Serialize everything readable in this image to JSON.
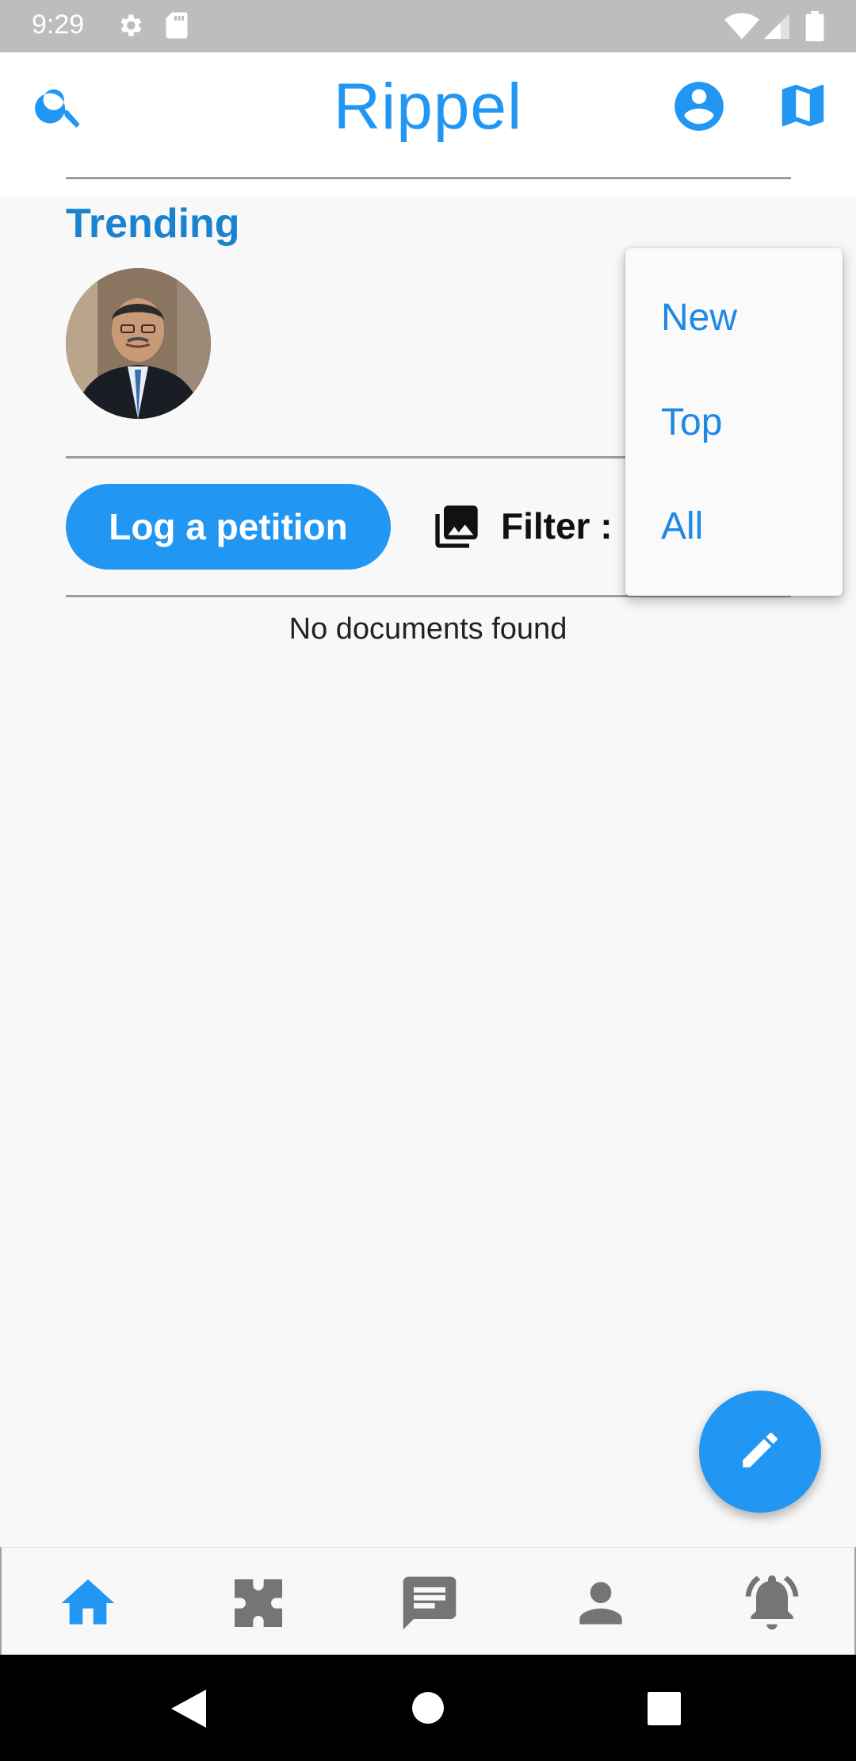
{
  "status_bar": {
    "time": "9:29",
    "icons": [
      "settings-icon",
      "sd-card-icon",
      "wifi-icon",
      "signal-icon",
      "battery-icon"
    ]
  },
  "app_bar": {
    "title": "Rippel",
    "left_icon": "search-icon",
    "right_icons": [
      "account-circle-icon",
      "map-icon"
    ]
  },
  "trending": {
    "title": "Trending"
  },
  "actions": {
    "log_petition_label": "Log a petition",
    "filter_label": "Filter :"
  },
  "results": {
    "empty_message": "No documents found"
  },
  "filter_menu": {
    "items": [
      "New",
      "Top",
      "All"
    ]
  },
  "fab": {
    "icon": "edit-icon"
  },
  "bottom_nav": {
    "items": [
      "home-icon",
      "extension-icon",
      "chat-icon",
      "person-icon",
      "notifications-active-icon"
    ],
    "active_index": 0
  },
  "colors": {
    "accent": "#2196f3",
    "trending": "#1a83cf",
    "inactive_icon": "#757575",
    "status_bar": "#bdbdbd"
  }
}
